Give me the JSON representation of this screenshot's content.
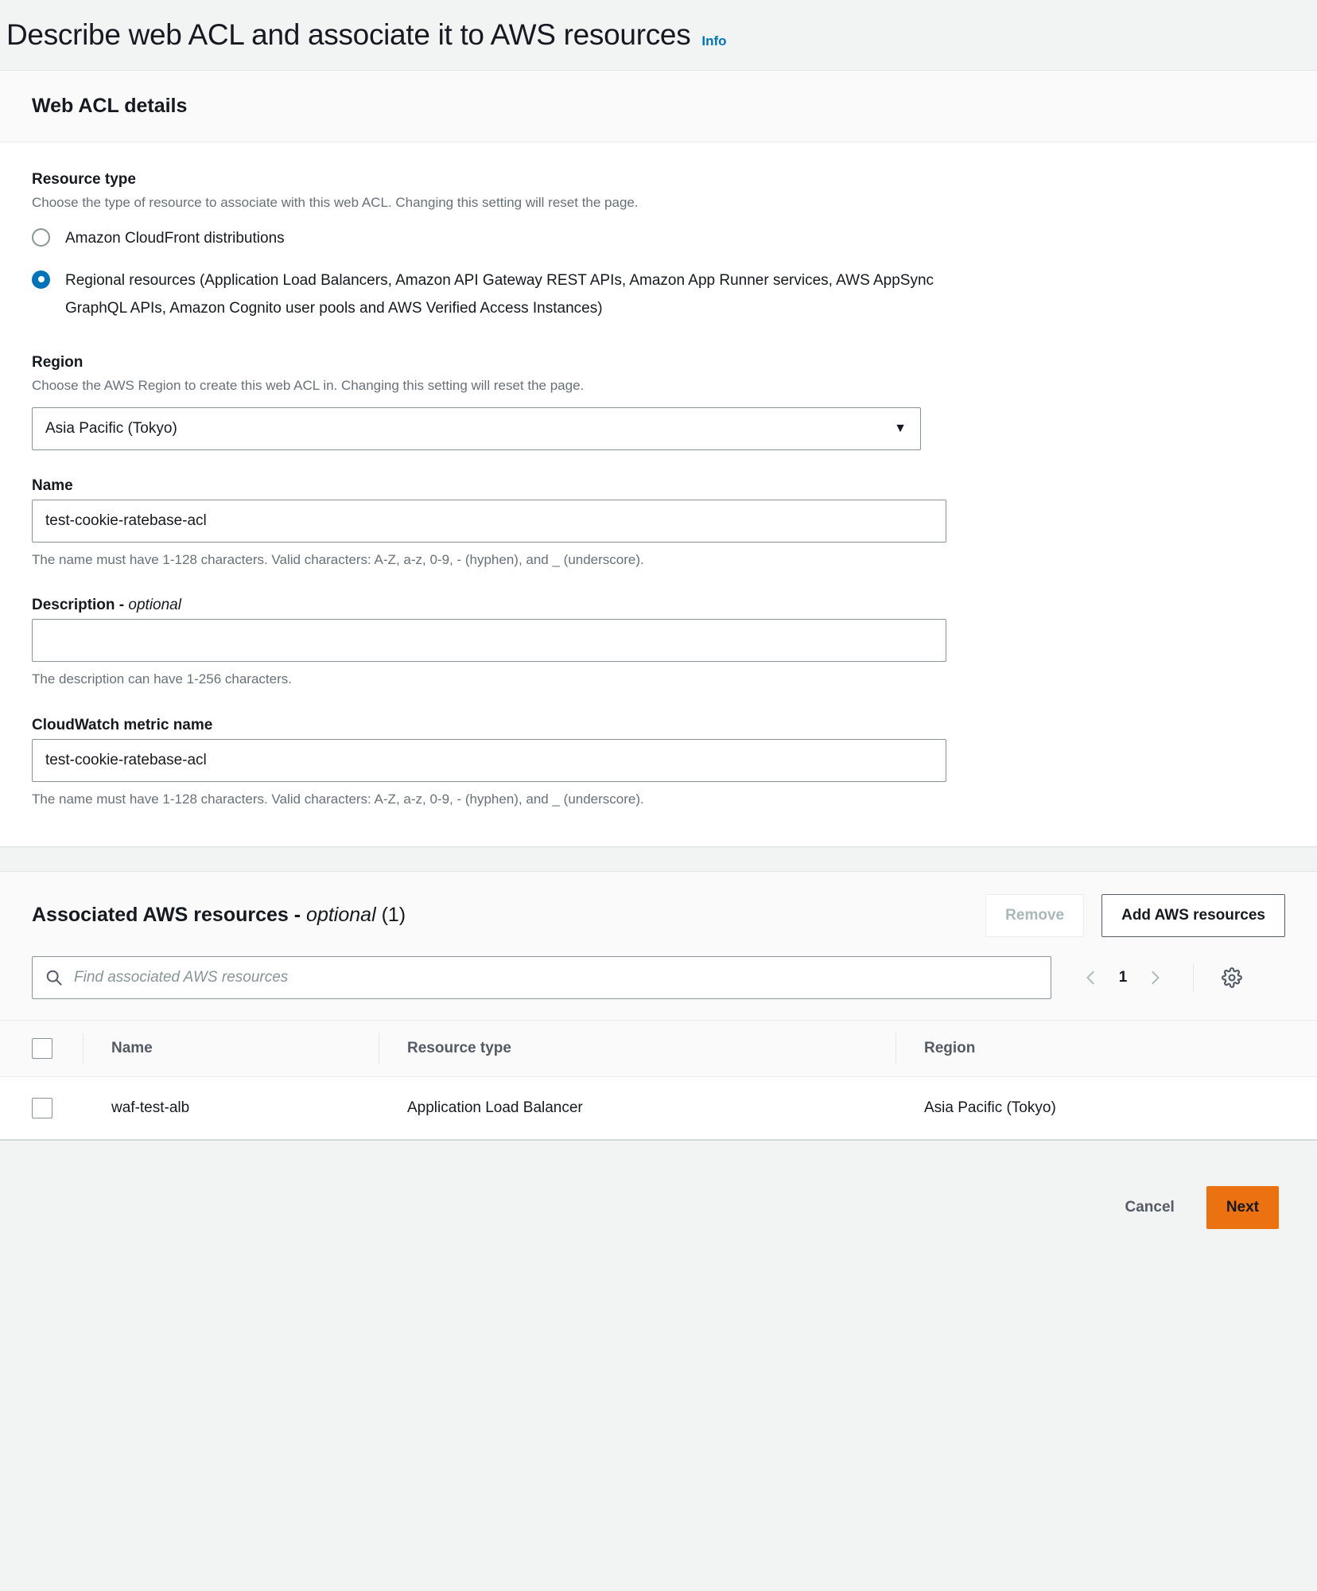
{
  "header": {
    "title": "Describe web ACL and associate it to AWS resources",
    "info_label": "Info"
  },
  "details_card": {
    "section_title": "Web ACL details",
    "resource_type": {
      "label": "Resource type",
      "description": "Choose the type of resource to associate with this web ACL. Changing this setting will reset the page.",
      "options": [
        {
          "label": "Amazon CloudFront distributions",
          "selected": false
        },
        {
          "label": "Regional resources (Application Load Balancers, Amazon API Gateway REST APIs, Amazon App Runner services, AWS AppSync GraphQL APIs, Amazon Cognito user pools and AWS Verified Access Instances)",
          "selected": true
        }
      ]
    },
    "region": {
      "label": "Region",
      "description": "Choose the AWS Region to create this web ACL in. Changing this setting will reset the page.",
      "selected_value": "Asia Pacific (Tokyo)"
    },
    "name": {
      "label": "Name",
      "value": "test-cookie-ratebase-acl",
      "hint": "The name must have 1-128 characters. Valid characters: A-Z, a-z, 0-9, - (hyphen), and _ (underscore)."
    },
    "description": {
      "label": "Description - ",
      "label_optional": "optional",
      "value": "",
      "placeholder": "",
      "hint": "The description can have 1-256 characters."
    },
    "cloudwatch_metric_name": {
      "label": "CloudWatch metric name",
      "value": "test-cookie-ratebase-acl",
      "hint": "The name must have 1-128 characters. Valid characters: A-Z, a-z, 0-9, - (hyphen), and _ (underscore)."
    }
  },
  "associated_resources": {
    "title_main": "Associated AWS resources - ",
    "title_optional": "optional",
    "title_count": " (1)",
    "remove_button": "Remove",
    "add_button": "Add AWS resources",
    "search_placeholder": "Find associated AWS resources",
    "page_number": "1",
    "columns": [
      "Name",
      "Resource type",
      "Region"
    ],
    "rows": [
      {
        "name": "waf-test-alb",
        "resource_type": "Application Load Balancer",
        "region": "Asia Pacific (Tokyo)"
      }
    ]
  },
  "footer": {
    "cancel_label": "Cancel",
    "next_label": "Next"
  },
  "colors": {
    "accent_blue": "#0073bb",
    "primary_orange": "#ec7211",
    "page_background": "#f2f3f3",
    "text_primary": "#16191f",
    "text_secondary": "#687078"
  }
}
